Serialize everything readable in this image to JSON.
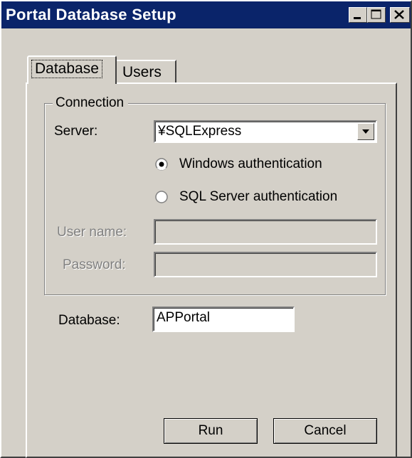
{
  "window": {
    "title": "Portal Database Setup",
    "controls": [
      "minimize-icon",
      "maximize-icon",
      "close-icon"
    ],
    "titlebar_color": "#0a246a",
    "face_color": "#d4d0c8"
  },
  "tabs": [
    {
      "label": "Database",
      "selected": true
    },
    {
      "label": "Users",
      "selected": false
    }
  ],
  "connection": {
    "legend": "Connection",
    "server_label": "Server:",
    "server_value": "¥SQLExpress",
    "auth_options": [
      {
        "label": "Windows authentication",
        "checked": true
      },
      {
        "label": "SQL Server authentication",
        "checked": false
      }
    ],
    "username_label": "User name:",
    "username_value": "",
    "password_label": "Password:",
    "password_value": ""
  },
  "database": {
    "label": "Database:",
    "value": "APPortal"
  },
  "buttons": {
    "run": "Run",
    "cancel": "Cancel"
  }
}
